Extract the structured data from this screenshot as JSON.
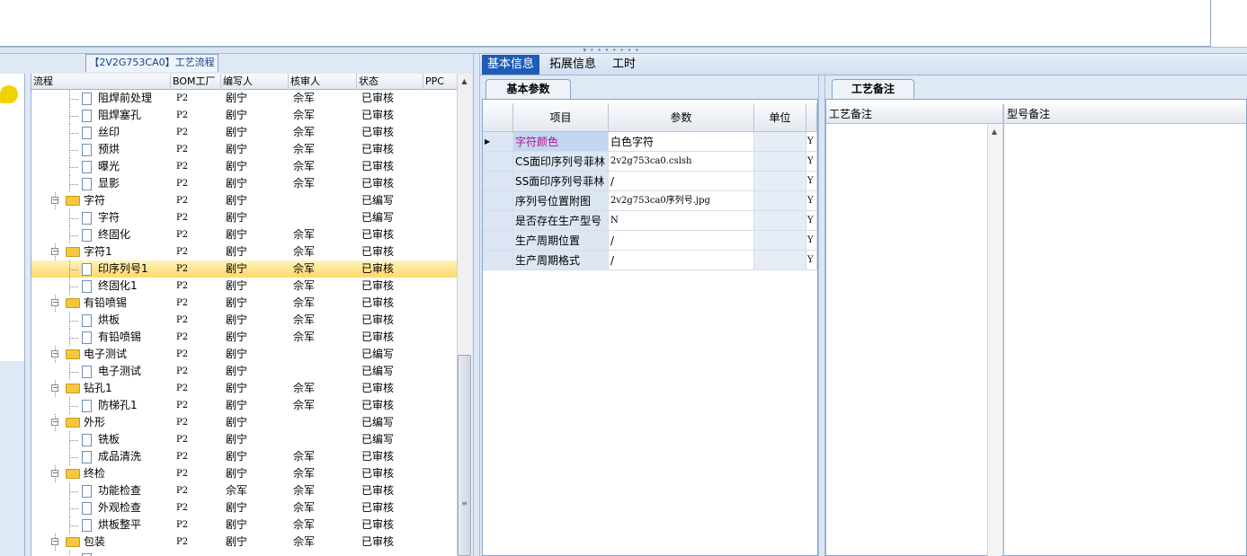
{
  "flow_tab": "【2V2G753CA0】工艺流程",
  "grid": {
    "columns": [
      "流程",
      "BOM工厂",
      "编写人",
      "核审人",
      "状态",
      "PPC"
    ],
    "rows": [
      {
        "label": "阻焊前处理",
        "type": "doc",
        "level": 2,
        "bom": "P2",
        "writer": "剧宁",
        "reviewer": "佘军",
        "status": "已审核"
      },
      {
        "label": "阻焊塞孔",
        "type": "doc",
        "level": 2,
        "bom": "P2",
        "writer": "剧宁",
        "reviewer": "佘军",
        "status": "已审核"
      },
      {
        "label": "丝印",
        "type": "doc",
        "level": 2,
        "bom": "P2",
        "writer": "剧宁",
        "reviewer": "佘军",
        "status": "已审核"
      },
      {
        "label": "预烘",
        "type": "doc",
        "level": 2,
        "bom": "P2",
        "writer": "剧宁",
        "reviewer": "佘军",
        "status": "已审核"
      },
      {
        "label": "曝光",
        "type": "doc",
        "level": 2,
        "bom": "P2",
        "writer": "剧宁",
        "reviewer": "佘军",
        "status": "已审核"
      },
      {
        "label": "显影",
        "type": "doc",
        "level": 2,
        "bom": "P2",
        "writer": "剧宁",
        "reviewer": "佘军",
        "status": "已审核"
      },
      {
        "label": "字符",
        "type": "folder",
        "level": 1,
        "bom": "P2",
        "writer": "剧宁",
        "reviewer": "",
        "status": "已编写"
      },
      {
        "label": "字符",
        "type": "doc",
        "level": 2,
        "bom": "P2",
        "writer": "剧宁",
        "reviewer": "",
        "status": "已编写"
      },
      {
        "label": "终固化",
        "type": "doc",
        "level": 2,
        "bom": "P2",
        "writer": "剧宁",
        "reviewer": "佘军",
        "status": "已审核"
      },
      {
        "label": "字符1",
        "type": "folder",
        "level": 1,
        "bom": "P2",
        "writer": "剧宁",
        "reviewer": "佘军",
        "status": "已审核"
      },
      {
        "label": "印序列号1",
        "type": "doc",
        "level": 2,
        "bom": "P2",
        "writer": "剧宁",
        "reviewer": "佘军",
        "status": "已审核",
        "selected": true
      },
      {
        "label": "终固化1",
        "type": "doc",
        "level": 2,
        "bom": "P2",
        "writer": "剧宁",
        "reviewer": "佘军",
        "status": "已审核"
      },
      {
        "label": "有铅喷锡",
        "type": "folder",
        "level": 1,
        "bom": "P2",
        "writer": "剧宁",
        "reviewer": "佘军",
        "status": "已审核"
      },
      {
        "label": "烘板",
        "type": "doc",
        "level": 2,
        "bom": "P2",
        "writer": "剧宁",
        "reviewer": "佘军",
        "status": "已审核"
      },
      {
        "label": "有铅喷锡",
        "type": "doc",
        "level": 2,
        "bom": "P2",
        "writer": "剧宁",
        "reviewer": "佘军",
        "status": "已审核"
      },
      {
        "label": "电子测试",
        "type": "folder",
        "level": 1,
        "bom": "P2",
        "writer": "剧宁",
        "reviewer": "",
        "status": "已编写"
      },
      {
        "label": "电子测试",
        "type": "doc",
        "level": 2,
        "bom": "P2",
        "writer": "剧宁",
        "reviewer": "",
        "status": "已编写"
      },
      {
        "label": "钻孔1",
        "type": "folder",
        "level": 1,
        "bom": "P2",
        "writer": "剧宁",
        "reviewer": "佘军",
        "status": "已审核"
      },
      {
        "label": "防梯孔1",
        "type": "doc",
        "level": 2,
        "bom": "P2",
        "writer": "剧宁",
        "reviewer": "佘军",
        "status": "已审核"
      },
      {
        "label": "外形",
        "type": "folder",
        "level": 1,
        "bom": "P2",
        "writer": "剧宁",
        "reviewer": "",
        "status": "已编写"
      },
      {
        "label": "铣板",
        "type": "doc",
        "level": 2,
        "bom": "P2",
        "writer": "剧宁",
        "reviewer": "",
        "status": "已编写"
      },
      {
        "label": "成品清洗",
        "type": "doc",
        "level": 2,
        "bom": "P2",
        "writer": "剧宁",
        "reviewer": "佘军",
        "status": "已审核"
      },
      {
        "label": "终检",
        "type": "folder",
        "level": 1,
        "bom": "P2",
        "writer": "剧宁",
        "reviewer": "佘军",
        "status": "已审核"
      },
      {
        "label": "功能检查",
        "type": "doc",
        "level": 2,
        "bom": "P2",
        "writer": "佘军",
        "reviewer": "佘军",
        "status": "已审核"
      },
      {
        "label": "外观检查",
        "type": "doc",
        "level": 2,
        "bom": "P2",
        "writer": "剧宁",
        "reviewer": "佘军",
        "status": "已审核"
      },
      {
        "label": "烘板整平",
        "type": "doc",
        "level": 2,
        "bom": "P2",
        "writer": "剧宁",
        "reviewer": "佘军",
        "status": "已审核"
      },
      {
        "label": "包装",
        "type": "folder",
        "level": 1,
        "bom": "P2",
        "writer": "剧宁",
        "reviewer": "佘军",
        "status": "已审核"
      },
      {
        "label": "",
        "type": "doc",
        "level": 2,
        "bom": "",
        "writer": "",
        "reviewer": "",
        "status": ""
      }
    ]
  },
  "top_tabs": [
    "基本信息",
    "拓展信息",
    "工时"
  ],
  "param_tab": "基本参数",
  "param_grid": {
    "columns": [
      "项目",
      "参数",
      "单位"
    ],
    "rows": [
      {
        "item": "字符颜色",
        "value": "白色字符",
        "unit": "",
        "flag": "Y",
        "highlight": true
      },
      {
        "item": "CS面印序列号菲林",
        "value": "2v2g753ca0.cslsh",
        "unit": "",
        "flag": "Y",
        "mono": true
      },
      {
        "item": "SS面印序列号菲林",
        "value": "/",
        "unit": "",
        "flag": "Y"
      },
      {
        "item": "序列号位置附图",
        "value": "2v2g753ca0序列号.jpg",
        "unit": "",
        "flag": "Y",
        "mono": true
      },
      {
        "item": "是否存在生产型号",
        "value": "N",
        "unit": "",
        "flag": "Y",
        "mono": true
      },
      {
        "item": "生产周期位置",
        "value": "/",
        "unit": "",
        "flag": "Y"
      },
      {
        "item": "生产周期格式",
        "value": "/",
        "unit": "",
        "flag": "Y"
      }
    ]
  },
  "remark_tab": "工艺备注",
  "remark_columns": [
    "工艺备注",
    "型号备注"
  ],
  "colors": {
    "accent": "#1e5cb5",
    "selected_row": "#fcd96a",
    "item_highlight": "#b5108a"
  }
}
